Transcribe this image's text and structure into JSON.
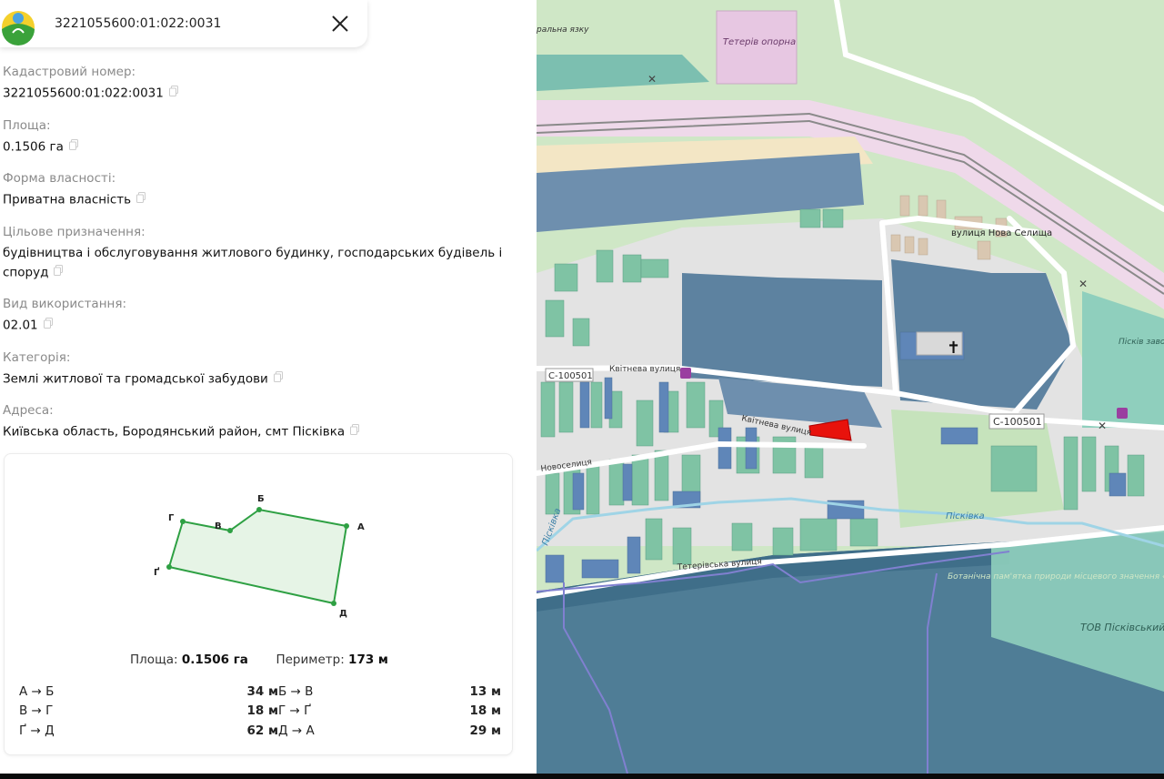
{
  "search": {
    "value": "3221055600:01:022:0031"
  },
  "fields": [
    {
      "label": "Кадастровий номер:",
      "value": "3221055600:01:022:0031"
    },
    {
      "label": "Площа:",
      "value": "0.1506 га"
    },
    {
      "label": "Форма власності:",
      "value": "Приватна власність"
    },
    {
      "label": "Цільове призначення:",
      "value": "будівництва і обслуговування житлового будинку, господарських будівель і споруд"
    },
    {
      "label": "Вид використання:",
      "value": "02.01"
    },
    {
      "label": "Категорія:",
      "value": "Землі житлової та громадської забудови"
    },
    {
      "label": "Адреса:",
      "value": "Київська область, Бородянський район, смт Пісківка"
    }
  ],
  "plot": {
    "vertices": [
      "А",
      "Б",
      "В",
      "Г",
      "Ґ",
      "Д"
    ],
    "area_label": "Площа:",
    "area_value": "0.1506 га",
    "perimeter_label": "Периметр:",
    "perimeter_value": "173 м",
    "segments": [
      {
        "left": "А → Б",
        "left_len": "34 м",
        "right": "Б → В",
        "right_len": "13 м"
      },
      {
        "left": "В → Г",
        "left_len": "18 м",
        "right": "Г → Ґ",
        "right_len": "18 м"
      },
      {
        "left": "Ґ → Д",
        "left_len": "62 м",
        "right": "Д → А",
        "right_len": "29 м"
      }
    ]
  },
  "map": {
    "labels": {
      "station": "Тетерів опорна",
      "street1": "вулиця Нова Селища",
      "street2": "Квітнева вулиця",
      "street3": "Квітнева вулиця",
      "road1": "С-100501",
      "road2": "С-100501",
      "street4": "Новоселиця",
      "street5": "Тетерівська вулиця",
      "river1": "Пісківка",
      "river2": "Пісківка",
      "factory": "ТОВ Пісківський завод скловироб",
      "factory2": "Пісків завод ск (ст майд",
      "reserve": "Ботанічна пам'ятка природи місцевого значення «Дуб»",
      "edge": "ральна язку"
    },
    "colors": {
      "forest": "#cfe7c6",
      "residential": "#e4e4e4",
      "water_dark": "#5b7f95",
      "parcel": "#e8120c"
    }
  }
}
